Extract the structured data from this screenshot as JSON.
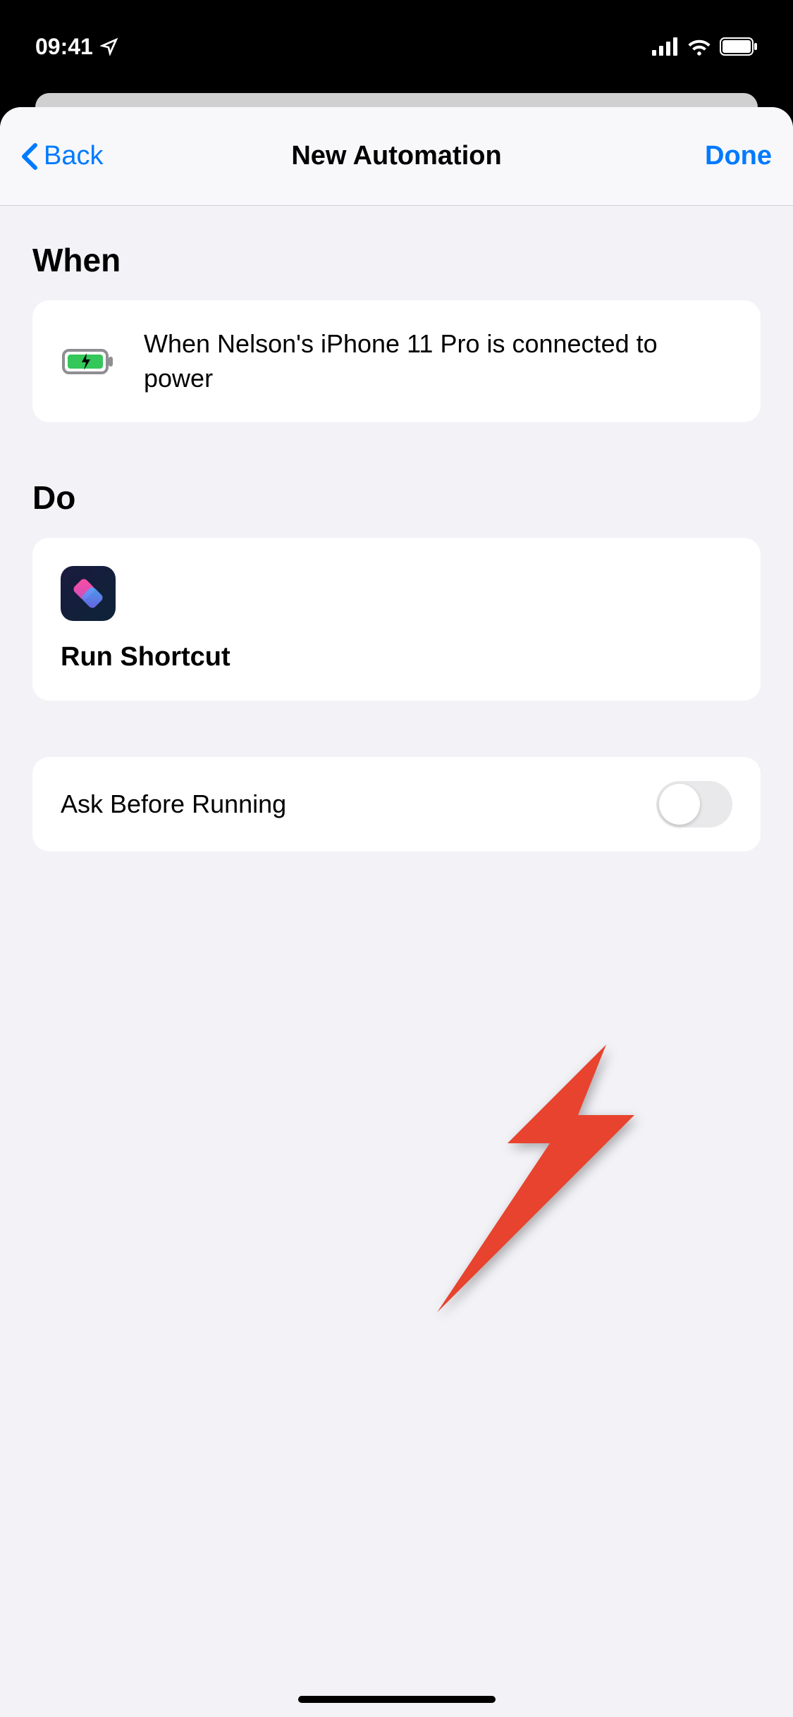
{
  "statusBar": {
    "time": "09:41"
  },
  "nav": {
    "back": "Back",
    "title": "New Automation",
    "done": "Done"
  },
  "sections": {
    "when": {
      "title": "When",
      "description": "When Nelson's iPhone 11 Pro is connected to power"
    },
    "do": {
      "title": "Do",
      "action": "Run Shortcut"
    },
    "askBefore": {
      "label": "Ask Before Running",
      "enabled": false
    }
  }
}
